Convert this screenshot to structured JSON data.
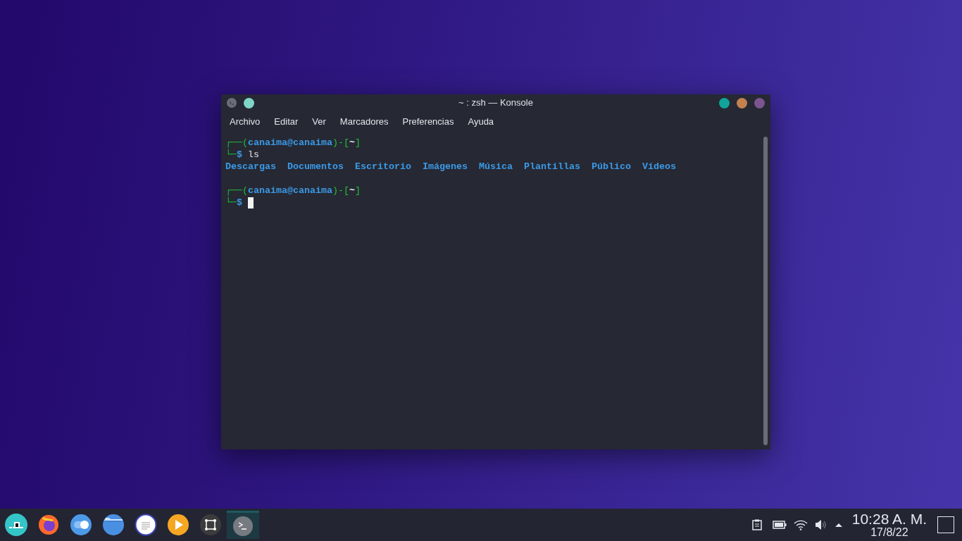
{
  "window": {
    "title": "~ : zsh — Konsole"
  },
  "menu": [
    "Archivo",
    "Editar",
    "Ver",
    "Marcadores",
    "Preferencias",
    "Ayuda"
  ],
  "terminal": {
    "lines": [
      {
        "kind": "text",
        "segments": [
          {
            "kind": "frame",
            "text": "┌──("
          },
          {
            "kind": "user",
            "text": "canaima@canaima"
          },
          {
            "kind": "frame",
            "text": ")-["
          },
          {
            "kind": "path",
            "text": "~"
          },
          {
            "kind": "frame",
            "text": "]"
          }
        ]
      },
      {
        "kind": "text",
        "segments": [
          {
            "kind": "frame",
            "text": "└─"
          },
          {
            "kind": "user",
            "text": "$"
          },
          {
            "kind": "cmd",
            "text": " ls"
          }
        ]
      },
      {
        "kind": "text",
        "segments": [
          {
            "kind": "dir",
            "text": "Descargas"
          },
          {
            "kind": "dir",
            "text": "Documentos"
          },
          {
            "kind": "dir",
            "text": "Escritorio"
          },
          {
            "kind": "dir",
            "text": "Imágenes"
          },
          {
            "kind": "dir",
            "text": "Música"
          },
          {
            "kind": "dir",
            "text": "Plantillas"
          },
          {
            "kind": "dir",
            "text": "Público"
          },
          {
            "kind": "dir",
            "text": "Vídeos"
          }
        ]
      },
      {
        "kind": "blank"
      },
      {
        "kind": "text",
        "segments": [
          {
            "kind": "frame",
            "text": "┌──("
          },
          {
            "kind": "user",
            "text": "canaima@canaima"
          },
          {
            "kind": "frame",
            "text": ")-["
          },
          {
            "kind": "path",
            "text": "~"
          },
          {
            "kind": "frame",
            "text": "]"
          }
        ]
      },
      {
        "kind": "text",
        "segments": [
          {
            "kind": "frame",
            "text": "└─"
          },
          {
            "kind": "user",
            "text": "$"
          },
          {
            "kind": "cursor"
          }
        ]
      }
    ]
  },
  "taskbar": {
    "launchers": [
      {
        "kind": "menu",
        "selected": false
      },
      {
        "kind": "browser",
        "selected": false
      },
      {
        "kind": "toggle",
        "selected": false
      },
      {
        "kind": "folder",
        "selected": false
      },
      {
        "kind": "document",
        "selected": false
      },
      {
        "kind": "player",
        "selected": false
      },
      {
        "kind": "screenshot",
        "selected": false
      },
      {
        "kind": "terminal",
        "selected": true
      }
    ],
    "clock": {
      "time": "10:28 A. M.",
      "date": "17/8/22"
    }
  }
}
